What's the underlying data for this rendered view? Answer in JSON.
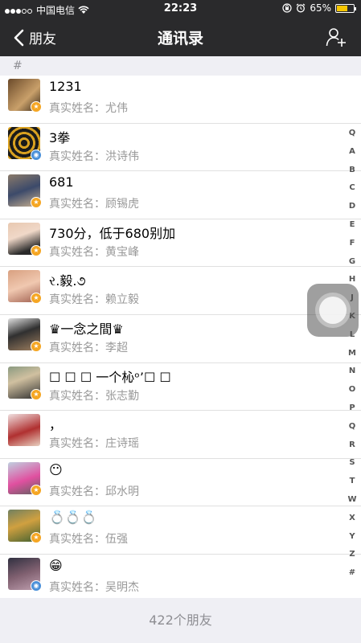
{
  "status_bar": {
    "carrier": "中国电信",
    "time": "22:23",
    "battery_percent": "65%",
    "battery_level": 0.65
  },
  "nav": {
    "back_label": "朋友",
    "title": "通讯录"
  },
  "section_header": "#",
  "contacts": [
    {
      "name": "1231",
      "real_name": "真实姓名：尤伟",
      "badge": "star"
    },
    {
      "name": "3拳",
      "real_name": "真实姓名：洪诗伟",
      "badge": "blue"
    },
    {
      "name": "681",
      "real_name": "真实姓名：顾锡虎",
      "badge": "star"
    },
    {
      "name": "730分，低于680别加",
      "real_name": "真实姓名：黄宝峰",
      "badge": "star"
    },
    {
      "name": "ર.毅.૭",
      "real_name": "真实姓名：赖立毅",
      "badge": "star"
    },
    {
      "name": "♛一念之間♛",
      "real_name": "真实姓名：李超",
      "badge": "star"
    },
    {
      "name": "☐ ☐ ☐ 一个杺ᵒ’☐ ☐",
      "real_name": "真实姓名：张志勤",
      "badge": "star"
    },
    {
      "name": "，",
      "real_name": "真实姓名：庄诗瑶",
      "badge": "none"
    },
    {
      "name": "😶",
      "real_name": "真实姓名：邱水明",
      "badge": "star"
    },
    {
      "name": "💍💍💍",
      "real_name": "真实姓名：伍强",
      "badge": "star"
    },
    {
      "name": "😁",
      "real_name": "真实姓名：吴明杰",
      "badge": "blue"
    }
  ],
  "index_letters": [
    "Q",
    "A",
    "B",
    "C",
    "D",
    "E",
    "F",
    "G",
    "H",
    "J",
    "K",
    "L",
    "M",
    "N",
    "O",
    "P",
    "Q",
    "R",
    "S",
    "T",
    "W",
    "X",
    "Y",
    "Z",
    "#"
  ],
  "footer": "422个朋友",
  "colors": {
    "nav_bg": "#2a2a2c",
    "badge_orange": "#f5a623",
    "badge_blue": "#4a90d9"
  }
}
